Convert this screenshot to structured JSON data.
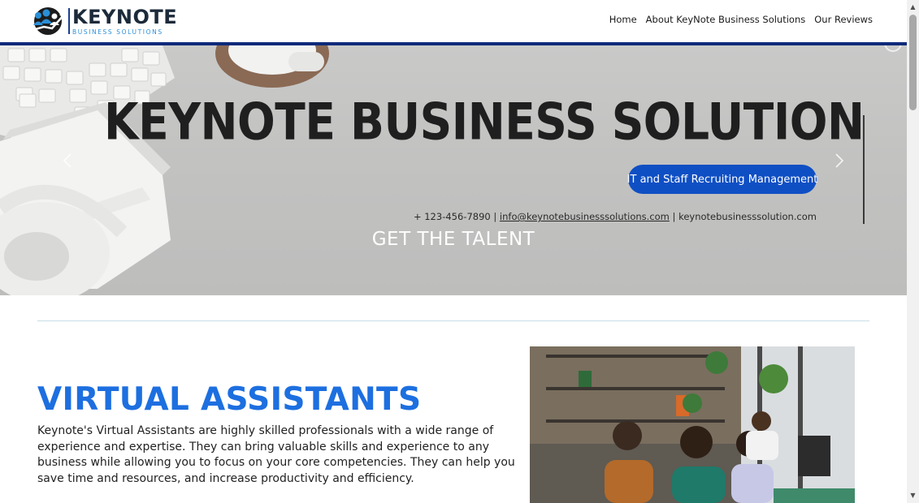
{
  "header": {
    "logo": {
      "word": "KEYNOTE",
      "tagline": "BUSINESS  SOLUTIONS"
    },
    "nav": [
      {
        "label": "Home"
      },
      {
        "label": "About KeyNote Business Solutions"
      },
      {
        "label": "Our Reviews"
      }
    ]
  },
  "hero": {
    "title": "KEYNOTE BUSINESS SOLUTION",
    "pill": "IT and Staff Recruiting Management",
    "contact": {
      "phone": "+ 123-456-7890",
      "separator": "|",
      "email": "info@keynotebusinesssolutions.com",
      "website": "keynotebusinesssolution.com"
    },
    "caption": "GET THE TALENT",
    "prev_icon": "chevron-left-icon",
    "next_icon": "chevron-right-icon"
  },
  "section": {
    "heading": "VIRTUAL ASSISTANTS",
    "body": "Keynote's Virtual Assistants are highly skilled professionals with a wide range of experience and expertise. They can bring valuable skills and experience to any business while allowing you to focus on your core competencies. They can help you save time and resources, and increase productivity and efficiency."
  },
  "colors": {
    "nav_bar_accent": "#0d2a7a",
    "heading_blue": "#1d6fe0",
    "pill_blue": "#0f4fc4"
  }
}
